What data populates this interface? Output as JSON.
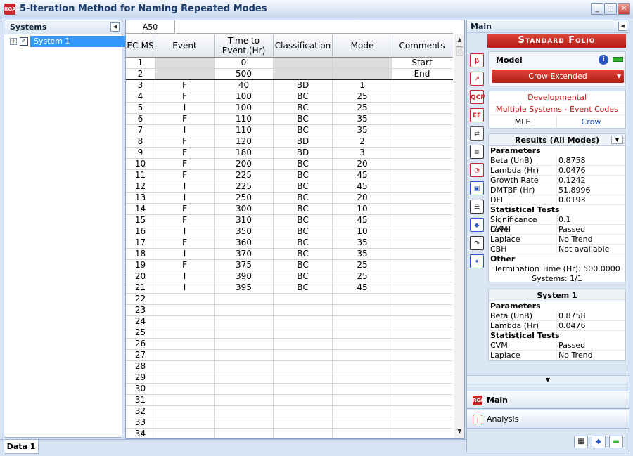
{
  "window": {
    "title": "5-Iteration Method for Naming Repeated Modes",
    "app_icon": "RGA",
    "minimize": "_",
    "maximize": "□",
    "close": "✕"
  },
  "systems": {
    "title": "Systems",
    "collapse": "◀",
    "expander": "+",
    "check": "✓",
    "items": [
      {
        "label": "System 1"
      }
    ]
  },
  "sheet": {
    "cell_ref": "A50",
    "columns": [
      "EC-MS",
      "Event",
      "Time to Event (Hr)",
      "Classification",
      "Mode",
      "Comments"
    ],
    "rows": [
      [
        "1",
        "",
        "0",
        "",
        "",
        "Start"
      ],
      [
        "2",
        "",
        "500",
        "",
        "",
        "End"
      ],
      [
        "3",
        "F",
        "40",
        "BD",
        "1",
        ""
      ],
      [
        "4",
        "F",
        "100",
        "BC",
        "25",
        ""
      ],
      [
        "5",
        "I",
        "100",
        "BC",
        "25",
        ""
      ],
      [
        "6",
        "F",
        "110",
        "BC",
        "35",
        ""
      ],
      [
        "7",
        "I",
        "110",
        "BC",
        "35",
        ""
      ],
      [
        "8",
        "F",
        "120",
        "BD",
        "2",
        ""
      ],
      [
        "9",
        "F",
        "180",
        "BD",
        "3",
        ""
      ],
      [
        "10",
        "F",
        "200",
        "BC",
        "20",
        ""
      ],
      [
        "11",
        "F",
        "225",
        "BC",
        "45",
        ""
      ],
      [
        "12",
        "I",
        "225",
        "BC",
        "45",
        ""
      ],
      [
        "13",
        "I",
        "250",
        "BC",
        "20",
        ""
      ],
      [
        "14",
        "F",
        "300",
        "BC",
        "10",
        ""
      ],
      [
        "15",
        "F",
        "310",
        "BC",
        "45",
        ""
      ],
      [
        "16",
        "I",
        "350",
        "BC",
        "10",
        ""
      ],
      [
        "17",
        "F",
        "360",
        "BC",
        "35",
        ""
      ],
      [
        "18",
        "I",
        "370",
        "BC",
        "35",
        ""
      ],
      [
        "19",
        "F",
        "375",
        "BC",
        "25",
        ""
      ],
      [
        "20",
        "I",
        "390",
        "BC",
        "25",
        ""
      ],
      [
        "21",
        "I",
        "395",
        "BC",
        "45",
        ""
      ],
      [
        "22",
        "",
        "",
        "",
        "",
        ""
      ],
      [
        "23",
        "",
        "",
        "",
        "",
        ""
      ],
      [
        "24",
        "",
        "",
        "",
        "",
        ""
      ],
      [
        "25",
        "",
        "",
        "",
        "",
        ""
      ],
      [
        "26",
        "",
        "",
        "",
        "",
        ""
      ],
      [
        "27",
        "",
        "",
        "",
        "",
        ""
      ],
      [
        "28",
        "",
        "",
        "",
        "",
        ""
      ],
      [
        "29",
        "",
        "",
        "",
        "",
        ""
      ],
      [
        "30",
        "",
        "",
        "",
        "",
        ""
      ],
      [
        "31",
        "",
        "",
        "",
        "",
        ""
      ],
      [
        "32",
        "",
        "",
        "",
        "",
        ""
      ],
      [
        "33",
        "",
        "",
        "",
        "",
        ""
      ],
      [
        "34",
        "",
        "",
        "",
        "",
        ""
      ]
    ],
    "scroll_up": "▲",
    "scroll_down": "▼",
    "tab": "Data 1"
  },
  "main_panel": {
    "title": "Main",
    "collapse": "◀",
    "banner": "Standard Folio",
    "model_label": "Model",
    "info": "i",
    "model_value": "Crow Extended",
    "dd_arrow": "▼",
    "settings": {
      "type": "Developmental",
      "data": "Multiple Systems - Event Codes",
      "method": "MLE",
      "model": "Crow"
    },
    "results": {
      "title": "Results (All Modes)",
      "chevron": "▼",
      "parameters_title": "Parameters",
      "parameters": [
        {
          "k": "Beta (UnB)",
          "v": "0.8758"
        },
        {
          "k": "Lambda (Hr)",
          "v": "0.0476"
        },
        {
          "k": "Growth Rate",
          "v": "0.1242"
        },
        {
          "k": "DMTBF (Hr)",
          "v": "51.8996"
        },
        {
          "k": "DFI",
          "v": "0.0193"
        }
      ],
      "tests_title": "Statistical Tests",
      "tests": [
        {
          "k": "Significance Level",
          "v": "0.1"
        },
        {
          "k": "CVM",
          "v": "Passed"
        },
        {
          "k": "Laplace",
          "v": "No Trend"
        },
        {
          "k": "CBH",
          "v": "Not available"
        }
      ],
      "other_title": "Other",
      "termination": "Termination Time (Hr): 500.0000",
      "systems_count": "Systems: 1/1"
    },
    "system1": {
      "title": "System 1",
      "parameters_title": "Parameters",
      "parameters": [
        {
          "k": "Beta (UnB)",
          "v": "0.8758"
        },
        {
          "k": "Lambda (Hr)",
          "v": "0.0476"
        }
      ],
      "tests_title": "Statistical Tests",
      "tests": [
        {
          "k": "CVM",
          "v": "Passed"
        },
        {
          "k": "Laplace",
          "v": "No Trend"
        }
      ]
    },
    "scroll_down": "▼",
    "nav": {
      "main": "Main",
      "analysis": "Analysis",
      "main_icon": "RGA",
      "analysis_icon": "∫"
    },
    "toolbar_icons": [
      {
        "name": "data-settings-icon",
        "glyph": "β",
        "color": "#c8262b"
      },
      {
        "name": "plot-icon",
        "glyph": "↗",
        "color": "#c8262b"
      },
      {
        "name": "qcp-icon",
        "glyph": "QCP",
        "color": "#c8262b"
      },
      {
        "name": "ef-icon",
        "glyph": "EF",
        "color": "#c8262b"
      },
      {
        "name": "transfer-icon",
        "glyph": "⇄",
        "color": "#555555"
      },
      {
        "name": "report-icon",
        "glyph": "≡",
        "color": "#333333"
      },
      {
        "name": "gauge-icon",
        "glyph": "◔",
        "color": "#c8262b"
      },
      {
        "name": "mission-icon",
        "glyph": "▣",
        "color": "#2b57c6"
      },
      {
        "name": "text-icon",
        "glyph": "☰",
        "color": "#333333"
      },
      {
        "name": "diagram-icon",
        "glyph": "◆",
        "color": "#2b57c6"
      },
      {
        "name": "redo-icon",
        "glyph": "↷",
        "color": "#333333"
      },
      {
        "name": "wizard-icon",
        "glyph": "✦",
        "color": "#2b57c6"
      }
    ],
    "bottom_icons": [
      {
        "name": "spreadsheet-icon",
        "glyph": "▦"
      },
      {
        "name": "diamond-icon",
        "glyph": "◆"
      },
      {
        "name": "status-green-icon",
        "glyph": "▬"
      }
    ]
  }
}
